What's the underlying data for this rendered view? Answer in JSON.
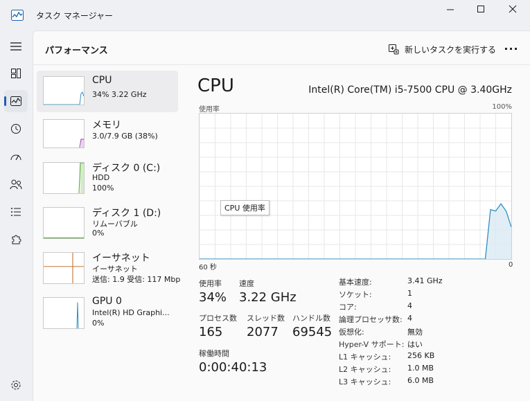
{
  "window": {
    "title": "タスク マネージャー"
  },
  "header": {
    "page_title": "パフォーマンス",
    "run_task_label": "新しいタスクを実行する",
    "more_label": "···"
  },
  "nav": {
    "items": [
      "menu-icon",
      "processes-icon",
      "performance-icon",
      "app-history-icon",
      "startup-icon",
      "users-icon",
      "details-icon",
      "services-icon",
      "settings-icon"
    ],
    "active": "performance"
  },
  "devices": [
    {
      "name": "CPU",
      "sub1": "34%  3.22 GHz",
      "color": "#2f8fc0",
      "fill": 0.34
    },
    {
      "name": "メモリ",
      "sub1": "3.0/7.9 GB (38%)",
      "color": "#9b3fb0",
      "fill": 0.38
    },
    {
      "name": "ディスク 0 (C:)",
      "sub1": "HDD",
      "sub2": "100%",
      "color": "#4aa32e",
      "fill": 1.0
    },
    {
      "name": "ディスク 1 (D:)",
      "sub1": "リムーバブル",
      "sub2": "0%",
      "color": "#4aa32e",
      "fill": 0
    },
    {
      "name": "イーサネット",
      "sub1": "イーサネット",
      "sub2": "送信: 1.9  受信: 117 Mbp",
      "color": "#b8651c",
      "fill": 0.05
    },
    {
      "name": "GPU 0",
      "sub1": "Intel(R) HD Graphi...",
      "sub2": "0%",
      "color": "#2f8fc0",
      "fill": 0
    }
  ],
  "detail": {
    "title": "CPU",
    "model": "Intel(R) Core(TM) i5-7500 CPU @ 3.40GHz",
    "graph_label_left": "使用率",
    "graph_label_right": "100%",
    "tooltip": "CPU 使用率",
    "axis_left": "60 秒",
    "axis_right": "0",
    "stats": {
      "usage_label": "使用率",
      "usage_value": "34%",
      "speed_label": "速度",
      "speed_value": "3.22 GHz",
      "processes_label": "プロセス数",
      "processes_value": "165",
      "threads_label": "スレッド数",
      "threads_value": "2077",
      "handles_label": "ハンドル数",
      "handles_value": "69545",
      "uptime_label": "稼働時間",
      "uptime_value": "0:00:40:13"
    },
    "specs": [
      {
        "k": "基本速度:",
        "v": "3.41 GHz"
      },
      {
        "k": "ソケット:",
        "v": "1"
      },
      {
        "k": "コア:",
        "v": "4"
      },
      {
        "k": "論理プロセッサ数:",
        "v": "4"
      },
      {
        "k": "仮想化:",
        "v": "無効"
      },
      {
        "k": "Hyper-V サポート:",
        "v": "はい"
      },
      {
        "k": "L1 キャッシュ:",
        "v": "256 KB"
      },
      {
        "k": "L2 キャッシュ:",
        "v": "1.0 MB"
      },
      {
        "k": "L3 キャッシュ:",
        "v": "6.0 MB"
      }
    ]
  },
  "chart_data": {
    "type": "area",
    "x": [
      60,
      5,
      4,
      3,
      2,
      1,
      0
    ],
    "values": [
      0,
      0,
      34,
      33,
      38,
      33,
      22
    ],
    "ylim": [
      0,
      100
    ],
    "xlim": [
      60,
      0
    ],
    "grid": true,
    "color": "#2f8fc0"
  }
}
